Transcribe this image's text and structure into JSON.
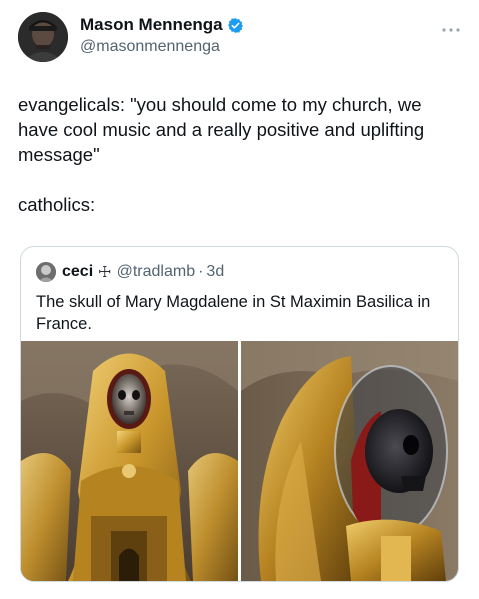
{
  "tweet": {
    "author": {
      "name": "Mason Mennenga",
      "handle": "@masonmennenga",
      "verified": true,
      "verified_color": "#1d9bf0"
    },
    "text": "evangelicals: \"you should come to my church, we have cool music and a really positive and uplifting message\"\n\ncatholics:",
    "more_icon": "more-dots-icon"
  },
  "quote": {
    "author_name": "ceci",
    "cross_glyph": "☩",
    "handle": "@tradlamb",
    "separator": "·",
    "time": "3d",
    "text": "The skull of Mary Magdalene in St Maximin Basilica in France.",
    "photos": [
      {
        "subject": "golden-reliquary-statue-front"
      },
      {
        "subject": "golden-reliquary-skull-side"
      }
    ]
  },
  "colors": {
    "text_primary": "#0f1419",
    "text_secondary": "#536471",
    "border": "#cfd9de",
    "gold": "#c99a2e"
  }
}
